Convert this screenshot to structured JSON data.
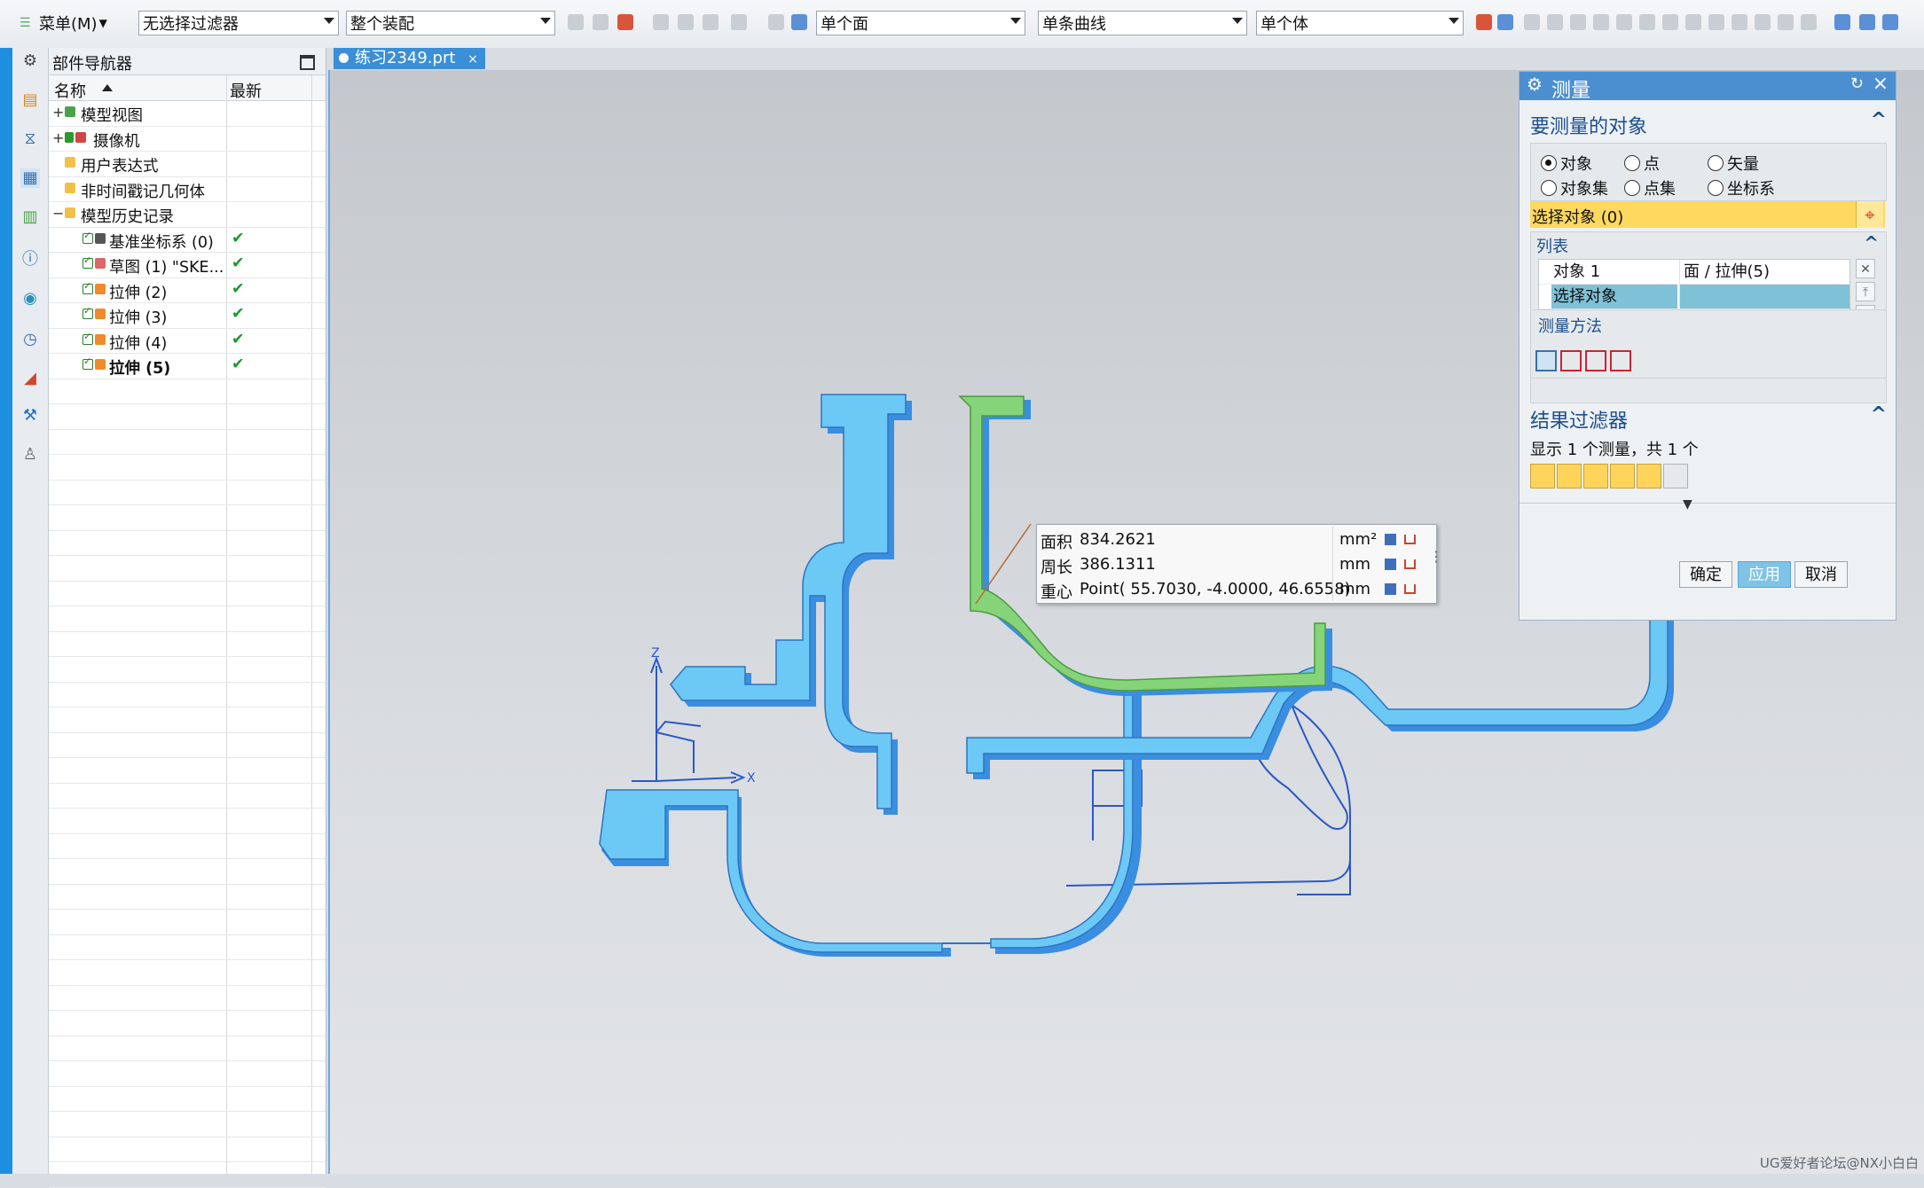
{
  "toolbar": {
    "menu_label": "菜单(M)",
    "selection_filter": "无选择过滤器",
    "scope": "整个装配",
    "face_rule": "单个面",
    "curve_rule": "单条曲线",
    "body_rule": "单个体"
  },
  "navigator": {
    "title": "部件导航器",
    "col_name": "名称",
    "col_latest": "最新",
    "rows": [
      {
        "label": "模型视图",
        "expander": "+",
        "check": ""
      },
      {
        "label": "摄像机",
        "expander": "+",
        "check": ""
      },
      {
        "label": "用户表达式",
        "expander": "",
        "check": ""
      },
      {
        "label": "非时间戳记几何体",
        "expander": "",
        "check": ""
      },
      {
        "label": "模型历史记录",
        "expander": "−",
        "check": ""
      },
      {
        "label": "基准坐标系 (0)",
        "expander": "",
        "check": "✔"
      },
      {
        "label": "草图 (1) \"SKE...",
        "expander": "",
        "check": "✔"
      },
      {
        "label": "拉伸 (2)",
        "expander": "",
        "check": "✔"
      },
      {
        "label": "拉伸 (3)",
        "expander": "",
        "check": "✔"
      },
      {
        "label": "拉伸 (4)",
        "expander": "",
        "check": "✔"
      },
      {
        "label": "拉伸 (5)",
        "expander": "",
        "check": "✔"
      }
    ]
  },
  "tab": {
    "file_name": "练习2349.prt"
  },
  "measure_tip": {
    "area_key": "面积",
    "area_value": "834.2621",
    "area_unit": "mm²",
    "perimeter_key": "周长",
    "perimeter_value": "386.1311",
    "perimeter_unit": "mm",
    "centroid_key": "重心",
    "centroid_value": "Point( 55.7030, -4.0000, 46.6558)",
    "centroid_unit": "mm"
  },
  "dialog": {
    "title": "测量",
    "section_objects": "要测量的对象",
    "radio_object": "对象",
    "radio_point": "点",
    "radio_vector": "矢量",
    "radio_object_set": "对象集",
    "radio_point_set": "点集",
    "radio_csys": "坐标系",
    "select_label": "选择对象 (0)",
    "list_title": "列表",
    "list_row1_name": "对象 1",
    "list_row1_value": "面 / 拉伸(5)",
    "list_row2_name": "选择对象",
    "method_title": "测量方法",
    "filter_title": "结果过滤器",
    "filter_status": "显示 1 个测量，共 1 个",
    "ok": "确定",
    "apply": "应用",
    "cancel": "取消"
  },
  "axes": {
    "x": "X",
    "z": "Z"
  },
  "watermark": "UG爱好者论坛@NX小白白",
  "colors": {
    "part_blue": "#6cc8f5",
    "part_side": "#3a8ee0",
    "selected_green": "#86d47a",
    "accent": "#4c8fd1",
    "highlight": "#ffd85f"
  }
}
